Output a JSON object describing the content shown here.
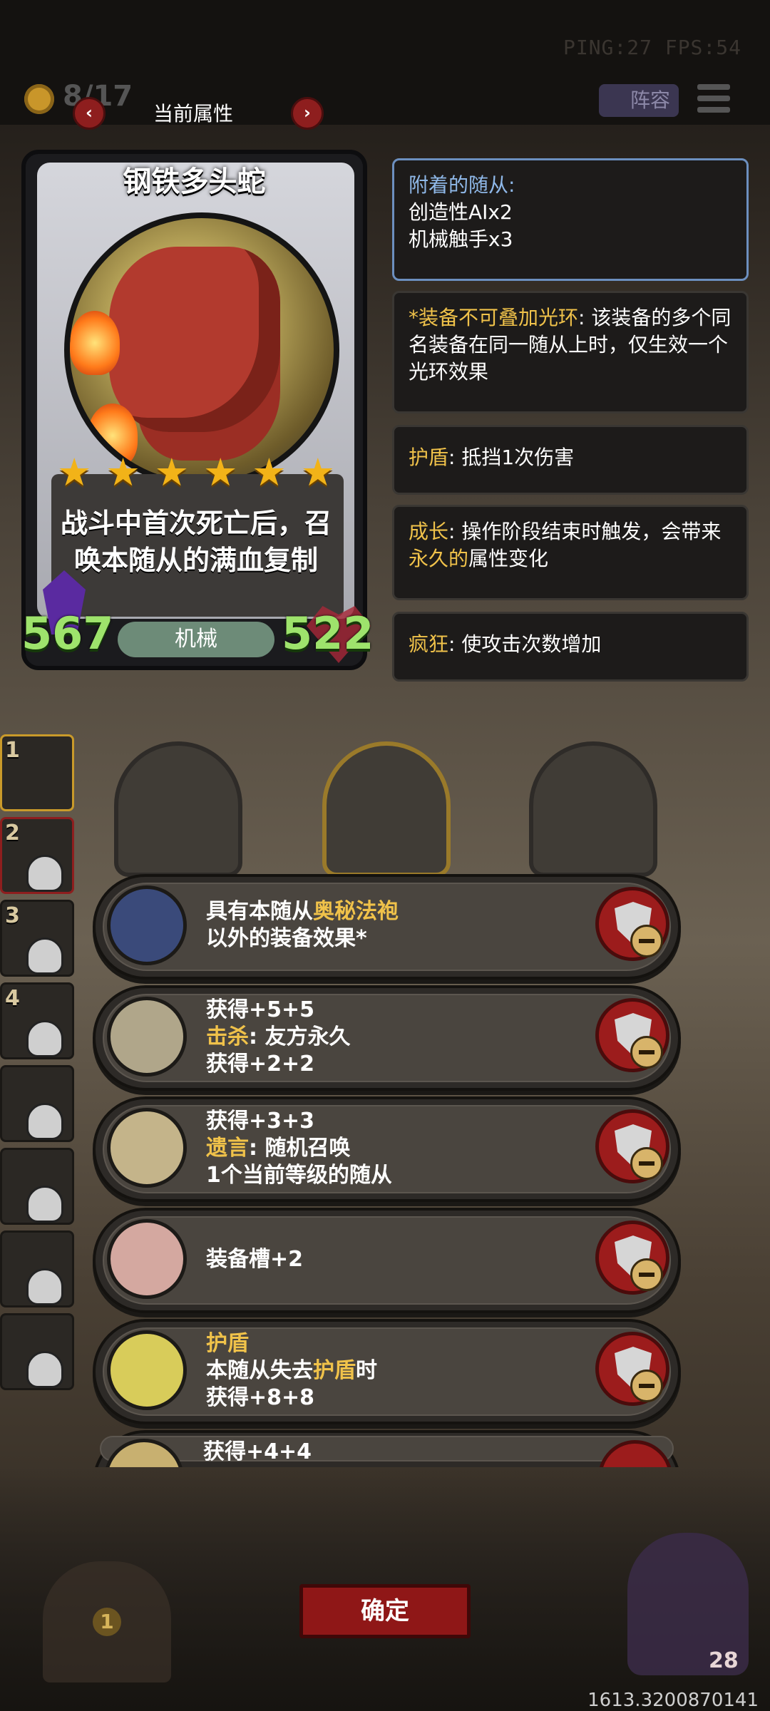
{
  "hud": {
    "ping_fps": "PING:27   FPS:54",
    "gold": "8/17",
    "lineup_label": "阵容"
  },
  "header": {
    "title": "当前属性",
    "prev": "‹",
    "next": "›"
  },
  "card": {
    "name": "钢铁多头蛇",
    "stars": 6,
    "description_line1": "战斗中首次死亡后，召",
    "description_line2": "唤本随从的满血复制",
    "attack": "567",
    "health": "522",
    "tribe": "机械"
  },
  "keywords": {
    "attached_title": "附着的随从:",
    "attached_1": "创造性AIx2",
    "attached_2": "机械触手x3",
    "aura_name": "*装备不可叠加光环",
    "aura_desc": ": 该装备的多个同名装备在同一随从上时，仅生效一个光环效果",
    "shield_name": "护盾",
    "shield_desc": ": 抵挡1次伤害",
    "growth_name": "成长",
    "growth_desc_a": ": 操作阶段结束时触发，会带来",
    "growth_highlight": "永久的",
    "growth_desc_b": "属性变化",
    "frenzy_name": "疯狂",
    "frenzy_desc": ": 使攻击次数增加"
  },
  "slots": [
    "1",
    "2",
    "3",
    "4"
  ],
  "equipment": [
    {
      "l1a": "具有本随从",
      "l1b": "奥秘法袍",
      "l2": "以外的装备效果*",
      "l3": ""
    },
    {
      "l1": "获得+5+5",
      "l2a": "击杀",
      "l2b": ": 友方永久",
      "l3": "获得+2+2"
    },
    {
      "l1": "获得+3+3",
      "l2a": "遗言",
      "l2b": ": 随机召唤",
      "l3": "1个当前等级的随从"
    },
    {
      "l1": "装备槽+2"
    },
    {
      "l1": "护盾",
      "l2a": "本随从失去",
      "l2b": "护盾",
      "l2c": "时",
      "l3": "获得+8+8"
    },
    {
      "l1": "获得+4+4"
    }
  ],
  "footer": {
    "confirm": "确定",
    "coords": "1613.3200870141",
    "count": "28",
    "coin": "1"
  },
  "colors": {
    "accent": "#f0c24a",
    "button_red": "#8f1717",
    "stat_green": "#9ee36c"
  }
}
